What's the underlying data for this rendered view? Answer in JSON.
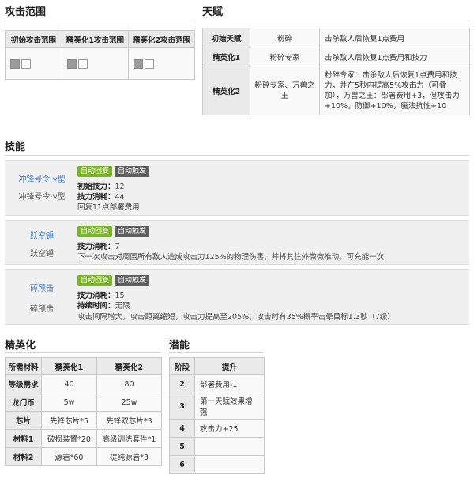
{
  "attack_range": {
    "heading": "攻击范围",
    "headers": [
      "初始攻击范围",
      "精英化1攻击范围",
      "精英化2攻击范围"
    ]
  },
  "talent": {
    "heading": "天赋",
    "rows": [
      {
        "stage": "初始天赋",
        "name": "粉碎",
        "desc": "击杀敌人后恢复1点费用"
      },
      {
        "stage": "精英化1",
        "name": "粉碎专家",
        "desc": "击杀敌人后恢复1点费用和技力"
      },
      {
        "stage": "精英化2",
        "name": "粉碎专家、万兽之王",
        "desc": "粉碎专家：击杀敌人后恢复1点费用和技力，并在5秒内提高5%攻击力（可叠加），万兽之王：部署费用+3，但攻击力+10%，防御+10%，魔法抗性+10"
      }
    ]
  },
  "skills": {
    "heading": "技能",
    "items": [
      {
        "name_link": "冲锋号令·γ型",
        "name_plain": "冲锋号令·γ型",
        "tag_recovery": "自动回复",
        "tag_trigger": "自动触发",
        "lines": [
          {
            "label": "初始技力：",
            "value": "12"
          },
          {
            "label": "技力消耗：",
            "value": "44"
          },
          {
            "label": "",
            "value": "回复11点部署费用"
          }
        ]
      },
      {
        "name_link": "跃空锤",
        "name_plain": "跃空锤",
        "tag_recovery": "自动回复",
        "tag_trigger": "自动触发",
        "lines": [
          {
            "label": "技力消耗：",
            "value": "7"
          },
          {
            "label": "",
            "value": "下一次攻击对周围所有敌人造成攻击力125%的物理伤害，并将其往外微微推动。可充能一次"
          }
        ]
      },
      {
        "name_link": "碎颅击",
        "name_plain": "碎颅击",
        "tag_recovery": "自动回复",
        "tag_trigger": "自动触发",
        "lines": [
          {
            "label": "技力消耗：",
            "value": "15"
          },
          {
            "label": "持续时间：",
            "value": "无限"
          },
          {
            "label": "",
            "value": "攻击间隔增大，攻击距离缩短，攻击力提高至205%，攻击时有35%概率击晕目标1.3秒（7级）"
          }
        ]
      }
    ]
  },
  "elite": {
    "heading": "精英化",
    "headers": [
      "所需材料",
      "精英化1",
      "精英化2"
    ],
    "rows": [
      {
        "label": "等级需求",
        "e1": "40",
        "e2": "80"
      },
      {
        "label": "龙门币",
        "e1": "5w",
        "e2": "25w"
      },
      {
        "label": "芯片",
        "e1": "先锋芯片*5",
        "e2": "先锋双芯片*3"
      },
      {
        "label": "材料1",
        "e1": "破损装置*20",
        "e2": "高级训练套件*1"
      },
      {
        "label": "材料2",
        "e1": "源岩*60",
        "e2": "提纯源岩*3"
      }
    ]
  },
  "potential": {
    "heading": "潜能",
    "headers": [
      "阶段",
      "提升"
    ],
    "rows": [
      {
        "stage": "2",
        "desc": "部署费用-1"
      },
      {
        "stage": "3",
        "desc": "第一天赋效果增强"
      },
      {
        "stage": "4",
        "desc": "攻击力+25"
      },
      {
        "stage": "5",
        "desc": ""
      },
      {
        "stage": "6",
        "desc": ""
      }
    ]
  }
}
